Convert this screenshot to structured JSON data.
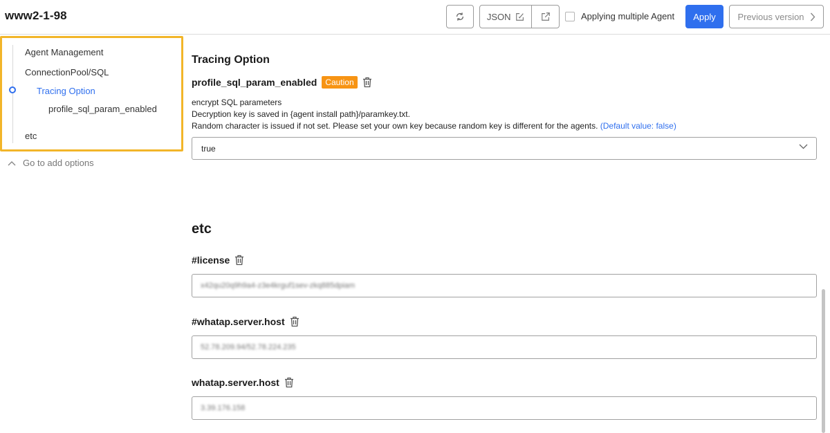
{
  "header": {
    "title": "www2-1-98",
    "json_label": "JSON",
    "multi_agent_label": "Applying multiple Agent",
    "apply_label": "Apply",
    "prev_version_label": "Previous version"
  },
  "sidebar": {
    "items": [
      {
        "label": "Agent Management"
      },
      {
        "label": "ConnectionPool/SQL"
      },
      {
        "label": "Tracing Option"
      },
      {
        "label": "profile_sql_param_enabled"
      },
      {
        "label": "etc"
      }
    ],
    "go_to_add_label": "Go to add options"
  },
  "main": {
    "section_title": "Tracing Option",
    "option": {
      "name": "profile_sql_param_enabled",
      "badge": "Caution",
      "desc_line1": "encrypt SQL parameters",
      "desc_line2": "Decryption key is saved in {agent install path}/paramkey.txt.",
      "desc_line3": "Random character is issued if not set. Please set your own key because random key is different for the agents.",
      "default_value": "(Default value: false)",
      "selected_value": "true"
    },
    "etc_title": "etc",
    "fields": [
      {
        "label": "#license",
        "value": "x42qu20q9h9a4-z3e4krguf1sev-zkq885dpiam"
      },
      {
        "label": "#whatap.server.host",
        "value": "52.78.209.94/52.78.224.235"
      },
      {
        "label": "whatap.server.host",
        "value": "3.39.176.158"
      }
    ]
  },
  "colors": {
    "accent": "#2f6fee",
    "caution": "#f79414",
    "sidebar_highlight": "#f2b529"
  }
}
